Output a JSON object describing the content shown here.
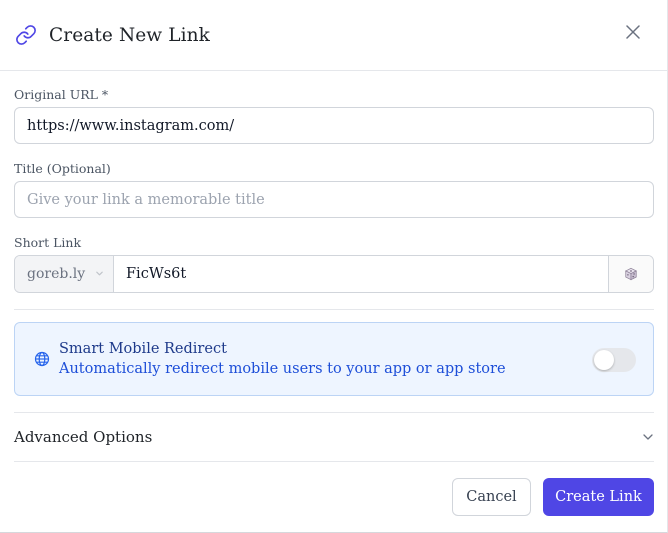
{
  "dialog": {
    "title": "Create New Link",
    "icon": "link-icon",
    "close_icon": "close-icon",
    "accent_color": "#4f46e5"
  },
  "fields": {
    "original_url": {
      "label": "Original URL *",
      "value": "https://www.instagram.com/",
      "placeholder": ""
    },
    "title": {
      "label": "Title (Optional)",
      "value": "",
      "placeholder": "Give your link a memorable title"
    },
    "short_link": {
      "label": "Short Link",
      "domain": "goreb.ly",
      "slug": "FicWs6t",
      "randomize_icon": "dice-icon"
    }
  },
  "smart_redirect": {
    "icon": "globe-icon",
    "title": "Smart Mobile Redirect",
    "description": "Automatically redirect mobile users to your app or app store",
    "enabled": false,
    "card_color": "#eef5ff"
  },
  "advanced": {
    "label": "Advanced Options",
    "icon": "chevron-down-icon",
    "expanded": false
  },
  "actions": {
    "cancel_label": "Cancel",
    "create_label": "Create Link"
  }
}
